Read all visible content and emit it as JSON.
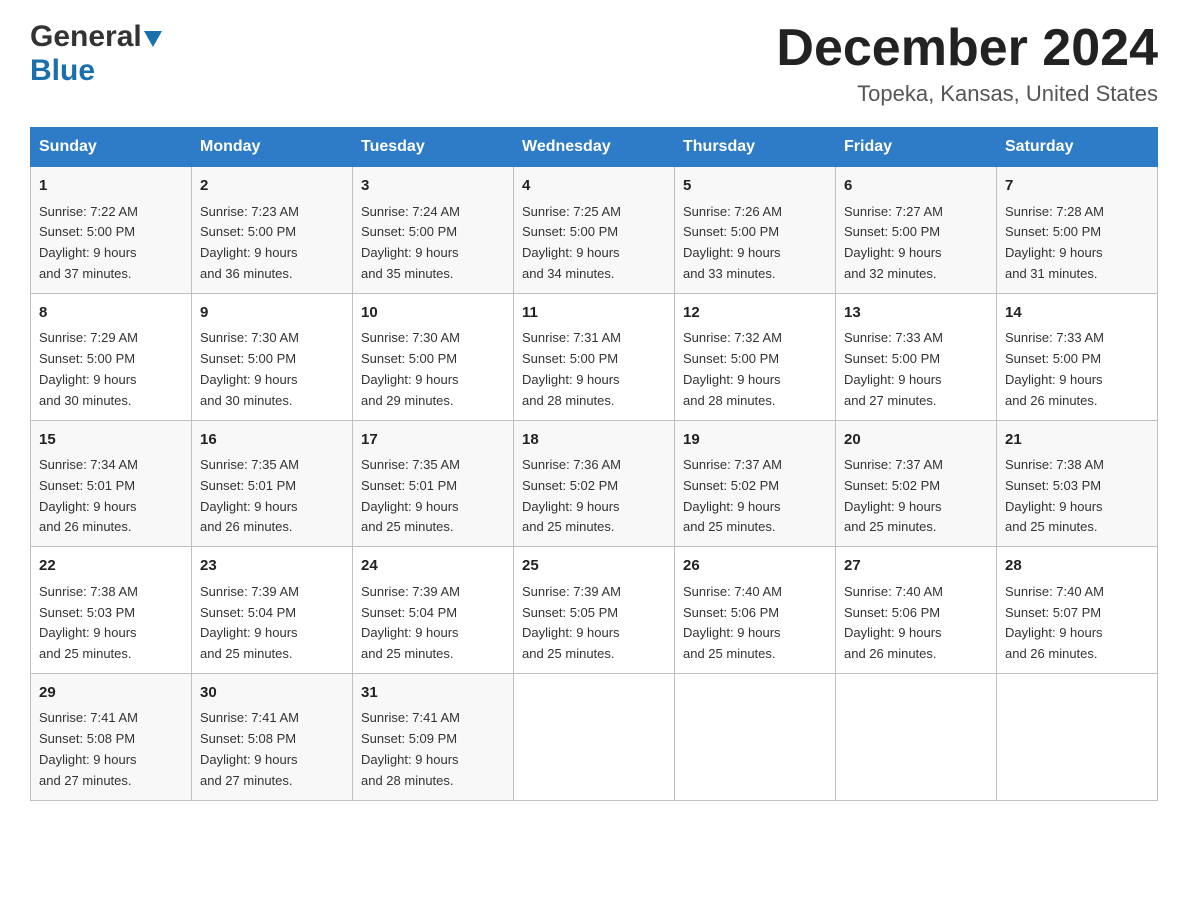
{
  "logo": {
    "general": "General",
    "blue": "Blue"
  },
  "header": {
    "month": "December 2024",
    "location": "Topeka, Kansas, United States"
  },
  "days_of_week": [
    "Sunday",
    "Monday",
    "Tuesday",
    "Wednesday",
    "Thursday",
    "Friday",
    "Saturday"
  ],
  "weeks": [
    [
      {
        "day": "1",
        "sunrise": "7:22 AM",
        "sunset": "5:00 PM",
        "daylight": "9 hours and 37 minutes."
      },
      {
        "day": "2",
        "sunrise": "7:23 AM",
        "sunset": "5:00 PM",
        "daylight": "9 hours and 36 minutes."
      },
      {
        "day": "3",
        "sunrise": "7:24 AM",
        "sunset": "5:00 PM",
        "daylight": "9 hours and 35 minutes."
      },
      {
        "day": "4",
        "sunrise": "7:25 AM",
        "sunset": "5:00 PM",
        "daylight": "9 hours and 34 minutes."
      },
      {
        "day": "5",
        "sunrise": "7:26 AM",
        "sunset": "5:00 PM",
        "daylight": "9 hours and 33 minutes."
      },
      {
        "day": "6",
        "sunrise": "7:27 AM",
        "sunset": "5:00 PM",
        "daylight": "9 hours and 32 minutes."
      },
      {
        "day": "7",
        "sunrise": "7:28 AM",
        "sunset": "5:00 PM",
        "daylight": "9 hours and 31 minutes."
      }
    ],
    [
      {
        "day": "8",
        "sunrise": "7:29 AM",
        "sunset": "5:00 PM",
        "daylight": "9 hours and 30 minutes."
      },
      {
        "day": "9",
        "sunrise": "7:30 AM",
        "sunset": "5:00 PM",
        "daylight": "9 hours and 30 minutes."
      },
      {
        "day": "10",
        "sunrise": "7:30 AM",
        "sunset": "5:00 PM",
        "daylight": "9 hours and 29 minutes."
      },
      {
        "day": "11",
        "sunrise": "7:31 AM",
        "sunset": "5:00 PM",
        "daylight": "9 hours and 28 minutes."
      },
      {
        "day": "12",
        "sunrise": "7:32 AM",
        "sunset": "5:00 PM",
        "daylight": "9 hours and 28 minutes."
      },
      {
        "day": "13",
        "sunrise": "7:33 AM",
        "sunset": "5:00 PM",
        "daylight": "9 hours and 27 minutes."
      },
      {
        "day": "14",
        "sunrise": "7:33 AM",
        "sunset": "5:00 PM",
        "daylight": "9 hours and 26 minutes."
      }
    ],
    [
      {
        "day": "15",
        "sunrise": "7:34 AM",
        "sunset": "5:01 PM",
        "daylight": "9 hours and 26 minutes."
      },
      {
        "day": "16",
        "sunrise": "7:35 AM",
        "sunset": "5:01 PM",
        "daylight": "9 hours and 26 minutes."
      },
      {
        "day": "17",
        "sunrise": "7:35 AM",
        "sunset": "5:01 PM",
        "daylight": "9 hours and 25 minutes."
      },
      {
        "day": "18",
        "sunrise": "7:36 AM",
        "sunset": "5:02 PM",
        "daylight": "9 hours and 25 minutes."
      },
      {
        "day": "19",
        "sunrise": "7:37 AM",
        "sunset": "5:02 PM",
        "daylight": "9 hours and 25 minutes."
      },
      {
        "day": "20",
        "sunrise": "7:37 AM",
        "sunset": "5:02 PM",
        "daylight": "9 hours and 25 minutes."
      },
      {
        "day": "21",
        "sunrise": "7:38 AM",
        "sunset": "5:03 PM",
        "daylight": "9 hours and 25 minutes."
      }
    ],
    [
      {
        "day": "22",
        "sunrise": "7:38 AM",
        "sunset": "5:03 PM",
        "daylight": "9 hours and 25 minutes."
      },
      {
        "day": "23",
        "sunrise": "7:39 AM",
        "sunset": "5:04 PM",
        "daylight": "9 hours and 25 minutes."
      },
      {
        "day": "24",
        "sunrise": "7:39 AM",
        "sunset": "5:04 PM",
        "daylight": "9 hours and 25 minutes."
      },
      {
        "day": "25",
        "sunrise": "7:39 AM",
        "sunset": "5:05 PM",
        "daylight": "9 hours and 25 minutes."
      },
      {
        "day": "26",
        "sunrise": "7:40 AM",
        "sunset": "5:06 PM",
        "daylight": "9 hours and 25 minutes."
      },
      {
        "day": "27",
        "sunrise": "7:40 AM",
        "sunset": "5:06 PM",
        "daylight": "9 hours and 26 minutes."
      },
      {
        "day": "28",
        "sunrise": "7:40 AM",
        "sunset": "5:07 PM",
        "daylight": "9 hours and 26 minutes."
      }
    ],
    [
      {
        "day": "29",
        "sunrise": "7:41 AM",
        "sunset": "5:08 PM",
        "daylight": "9 hours and 27 minutes."
      },
      {
        "day": "30",
        "sunrise": "7:41 AM",
        "sunset": "5:08 PM",
        "daylight": "9 hours and 27 minutes."
      },
      {
        "day": "31",
        "sunrise": "7:41 AM",
        "sunset": "5:09 PM",
        "daylight": "9 hours and 28 minutes."
      },
      null,
      null,
      null,
      null
    ]
  ],
  "labels": {
    "sunrise": "Sunrise: ",
    "sunset": "Sunset: ",
    "daylight": "Daylight: "
  }
}
